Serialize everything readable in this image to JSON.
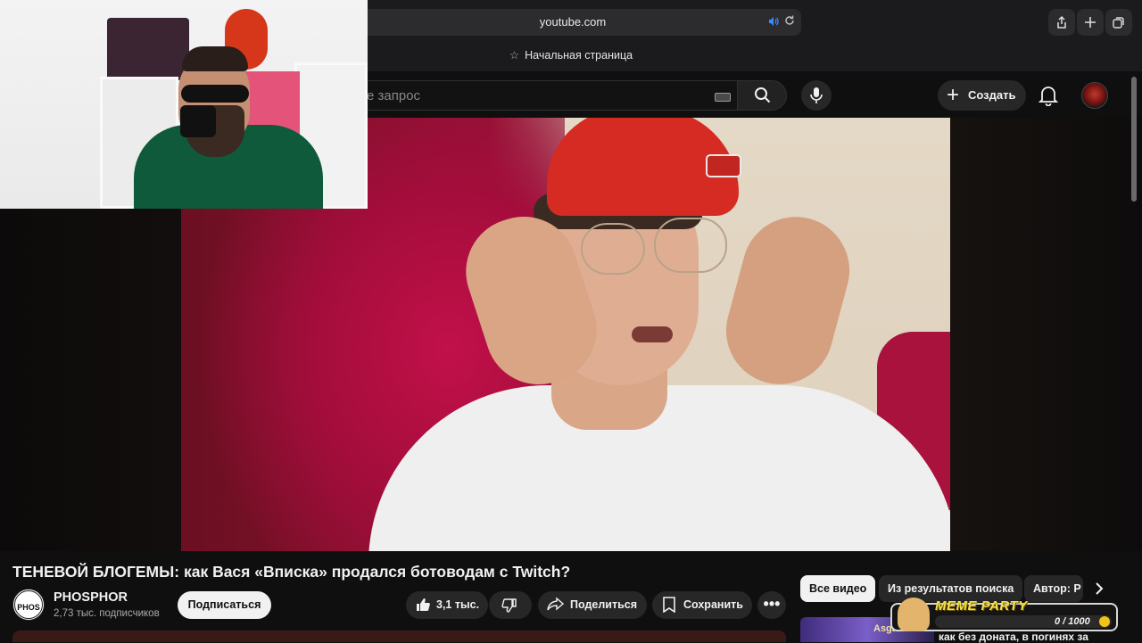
{
  "browser": {
    "url": "youtube.com",
    "favorites_label": "Начальная страница",
    "audio_icon": "speaker-icon",
    "reload_icon": "reload-icon"
  },
  "header": {
    "search_placeholder": "е запрос",
    "create_label": "Создать"
  },
  "video": {
    "title": "ТЕНЕВОЙ БЛОГЕМЫ: как Вася «Вписка» продался ботоводам с Twitch?"
  },
  "channel": {
    "name": "PHOSPHOR",
    "subscribers": "2,73 тыс. подписчиков",
    "subscribe_label": "Подписаться",
    "avatar_text": "PHOS"
  },
  "actions": {
    "likes": "3,1 тыс.",
    "share_label": "Поделиться",
    "save_label": "Сохранить"
  },
  "chips": {
    "all": "Все видео",
    "results": "Из результатов поиска",
    "author": "Автор: P"
  },
  "recommendation": {
    "thumb_label": "Asgard P",
    "title": "как без доната, в погинях за"
  },
  "meme_widget": {
    "title": "MEME PARTY",
    "count": "0 / 1000"
  },
  "colors": {
    "accent_blue": "#3a8bff",
    "meme_yellow": "#f4e24a",
    "cap_red": "#d52b22"
  }
}
